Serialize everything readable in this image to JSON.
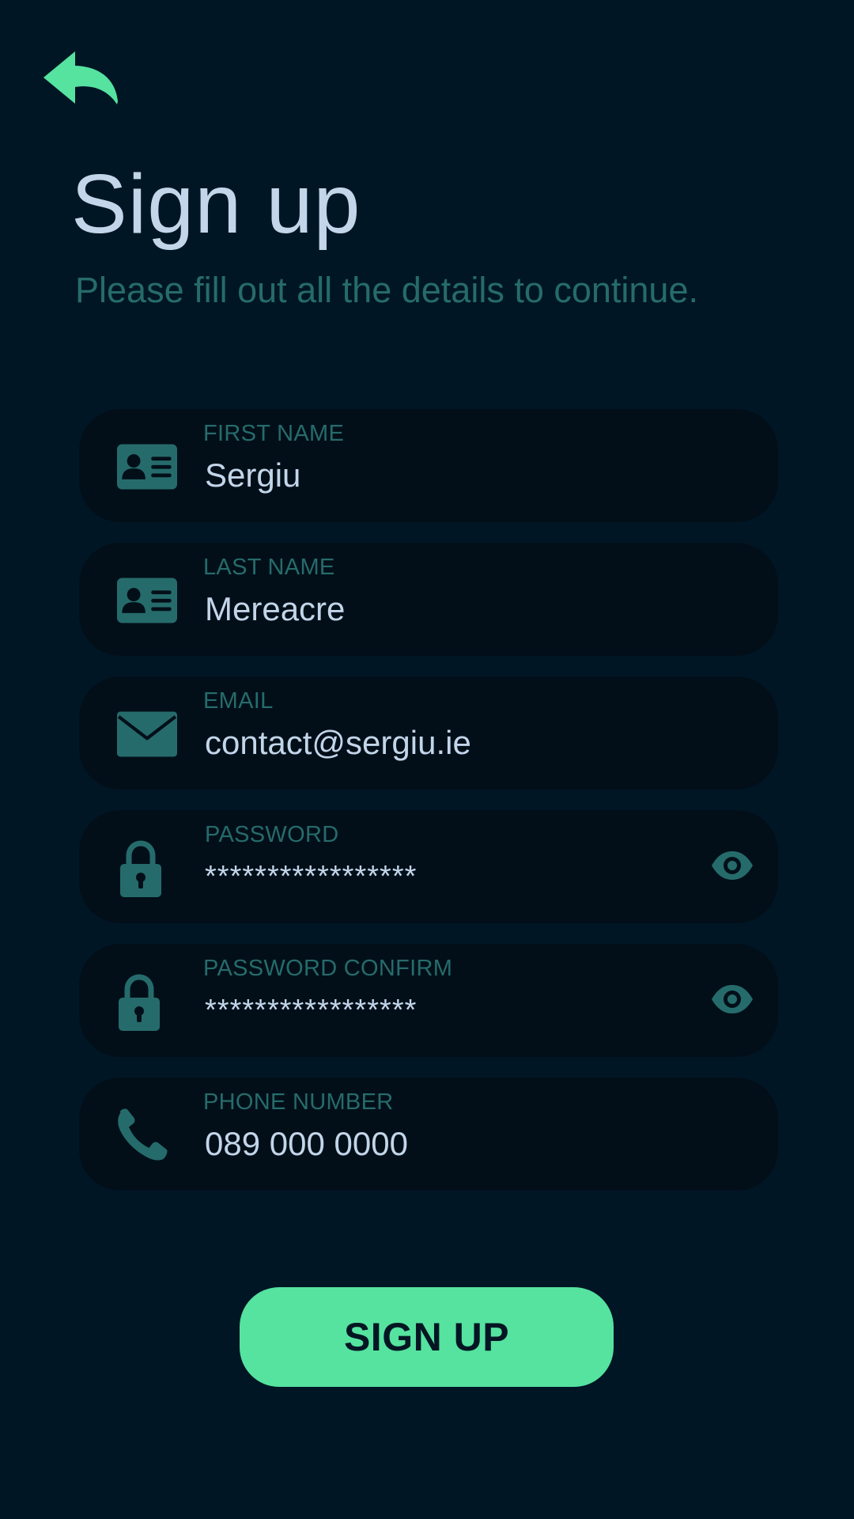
{
  "header": {
    "back_icon": "back-arrow-icon",
    "title": "Sign up",
    "subtitle": "Please fill out all the details to continue."
  },
  "form": {
    "first_name": {
      "label": "FIRST NAME",
      "value": "Sergiu",
      "icon": "id-card-icon"
    },
    "last_name": {
      "label": "LAST NAME",
      "value": "Mereacre",
      "icon": "id-card-icon"
    },
    "email": {
      "label": "EMAIL",
      "value": "contact@sergiu.ie",
      "icon": "envelope-icon"
    },
    "password": {
      "label": "PASSWORD",
      "value": "*****************",
      "icon": "lock-icon",
      "toggle_icon": "eye-icon"
    },
    "password_confirm": {
      "label": "PASSWORD CONFIRM",
      "value": "*****************",
      "icon": "lock-icon",
      "toggle_icon": "eye-icon"
    },
    "phone": {
      "label": "PHONE NUMBER",
      "value": "089 000 0000",
      "icon": "phone-icon"
    }
  },
  "actions": {
    "signup_label": "SIGN UP"
  },
  "colors": {
    "background": "#011625",
    "field_background": "#020f19",
    "accent": "#55e39f",
    "muted_teal": "#266b6b",
    "text_light": "#c3d5e9"
  }
}
